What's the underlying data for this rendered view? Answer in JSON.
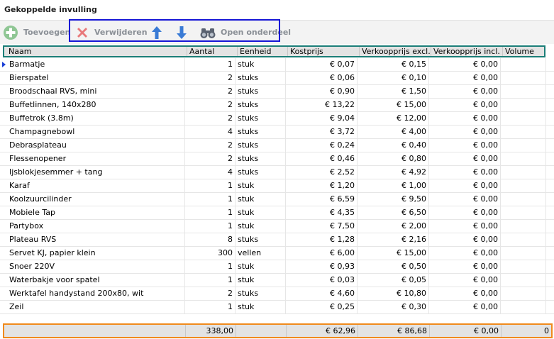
{
  "title": "Gekoppelde invulling",
  "toolbar": {
    "add_label": "Toevoegen",
    "delete_label": "Verwijderen",
    "open_label": "Open onderdeel"
  },
  "columns": [
    "Naam",
    "Aantal",
    "Eenheid",
    "Kostprijs",
    "Verkoopprijs excl.",
    "Verkoopprijs incl.",
    "Volume"
  ],
  "rows": [
    {
      "naam": "Barmatje",
      "aantal": "1",
      "eenheid": "stuk",
      "kost": "€ 0,07",
      "excl": "€ 0,15",
      "incl": "€ 0,00"
    },
    {
      "naam": "Bierspatel",
      "aantal": "2",
      "eenheid": "stuks",
      "kost": "€ 0,06",
      "excl": "€ 0,10",
      "incl": "€ 0,00"
    },
    {
      "naam": "Broodschaal RVS, mini",
      "aantal": "2",
      "eenheid": "stuks",
      "kost": "€ 0,90",
      "excl": "€ 1,50",
      "incl": "€ 0,00"
    },
    {
      "naam": "Buffetlinnen, 140x280",
      "aantal": "2",
      "eenheid": "stuks",
      "kost": "€ 13,22",
      "excl": "€ 15,00",
      "incl": "€ 0,00"
    },
    {
      "naam": "Buffetrok (3.8m)",
      "aantal": "2",
      "eenheid": "stuks",
      "kost": "€ 9,04",
      "excl": "€ 12,00",
      "incl": "€ 0,00"
    },
    {
      "naam": "Champagnebowl",
      "aantal": "4",
      "eenheid": "stuks",
      "kost": "€ 3,72",
      "excl": "€ 4,00",
      "incl": "€ 0,00"
    },
    {
      "naam": "Debrasplateau",
      "aantal": "2",
      "eenheid": "stuks",
      "kost": "€ 0,24",
      "excl": "€ 0,40",
      "incl": "€ 0,00"
    },
    {
      "naam": "Flessenopener",
      "aantal": "2",
      "eenheid": "stuks",
      "kost": "€ 0,46",
      "excl": "€ 0,80",
      "incl": "€ 0,00"
    },
    {
      "naam": "Ijsblokjesemmer + tang",
      "aantal": "4",
      "eenheid": "stuks",
      "kost": "€ 2,52",
      "excl": "€ 4,92",
      "incl": "€ 0,00"
    },
    {
      "naam": "Karaf",
      "aantal": "1",
      "eenheid": "stuk",
      "kost": "€ 1,20",
      "excl": "€ 1,00",
      "incl": "€ 0,00"
    },
    {
      "naam": "Koolzuurcilinder",
      "aantal": "1",
      "eenheid": "stuk",
      "kost": "€ 6,59",
      "excl": "€ 9,50",
      "incl": "€ 0,00"
    },
    {
      "naam": "Mobiele Tap",
      "aantal": "1",
      "eenheid": "stuk",
      "kost": "€ 4,35",
      "excl": "€ 6,50",
      "incl": "€ 0,00"
    },
    {
      "naam": "Partybox",
      "aantal": "1",
      "eenheid": "stuk",
      "kost": "€ 7,50",
      "excl": "€ 2,00",
      "incl": "€ 0,00"
    },
    {
      "naam": "Plateau RVS",
      "aantal": "8",
      "eenheid": "stuks",
      "kost": "€ 1,28",
      "excl": "€ 2,16",
      "incl": "€ 0,00"
    },
    {
      "naam": "Servet KJ, papier klein",
      "aantal": "300",
      "eenheid": "vellen",
      "kost": "€ 6,00",
      "excl": "€ 15,00",
      "incl": "€ 0,00"
    },
    {
      "naam": "Snoer 220V",
      "aantal": "1",
      "eenheid": "stuk",
      "kost": "€ 0,93",
      "excl": "€ 0,50",
      "incl": "€ 0,00"
    },
    {
      "naam": "Waterbakje voor spatel",
      "aantal": "1",
      "eenheid": "stuk",
      "kost": "€ 0,03",
      "excl": "€ 0,05",
      "incl": "€ 0,00"
    },
    {
      "naam": "Werktafel handystand 200x80, wit",
      "aantal": "2",
      "eenheid": "stuks",
      "kost": "€ 4,60",
      "excl": "€ 10,80",
      "incl": "€ 0,00"
    },
    {
      "naam": "Zeil",
      "aantal": "1",
      "eenheid": "stuk",
      "kost": "€ 0,25",
      "excl": "€ 0,30",
      "incl": "€ 0,00"
    }
  ],
  "totals": {
    "aantal": "338,00",
    "kost": "€ 62,96",
    "excl": "€ 86,68",
    "incl": "€ 0,00",
    "volume": "0"
  },
  "icons": {
    "add": "plus-circle-icon",
    "delete": "red-x-icon",
    "up": "arrow-up-icon",
    "down": "arrow-down-icon",
    "open": "binoculars-icon"
  },
  "colors": {
    "arrow_blue": "#3a7bd5",
    "delete_red": "#e05a5a",
    "add_green": "#74b87a",
    "highlight_blue": "#1515d6",
    "highlight_teal": "#1b7e78",
    "highlight_orange": "#f08a1c"
  }
}
